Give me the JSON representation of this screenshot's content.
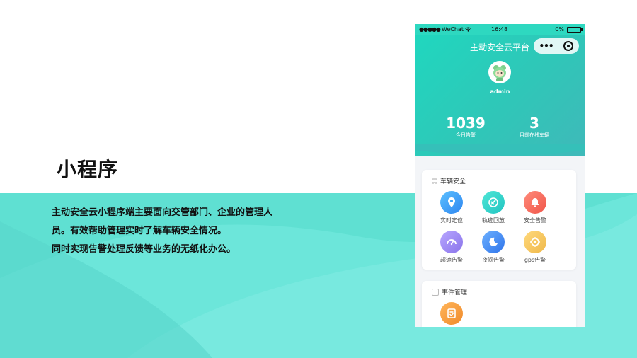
{
  "slide": {
    "title": "小程序",
    "description_lines": [
      "主动安全云小程序端主要面向交管部门、企业的管理人",
      "员。有效帮助管理实时了解车辆安全情况。",
      "同时实现告警处理反馈等业务的无纸化办公。"
    ]
  },
  "phone": {
    "statusbar": {
      "carrier": "WeChat",
      "time": "16:48",
      "battery": "0%"
    },
    "nav_title": "主动安全云平台",
    "user": {
      "name": "admin"
    },
    "stats": [
      {
        "value": "1039",
        "label": "今日告警"
      },
      {
        "value": "3",
        "label": "目前在线车辆"
      }
    ],
    "sections": [
      {
        "title": "车辆安全",
        "items": [
          {
            "label": "实时定位",
            "icon": "location-pin-icon",
            "color": "#3fa2f7"
          },
          {
            "label": "轨迹回放",
            "icon": "track-replay-icon",
            "color": "#2dd4c4"
          },
          {
            "label": "安全告警",
            "icon": "bell-icon",
            "color": "#f26a5c"
          },
          {
            "label": "超速告警",
            "icon": "speedometer-icon",
            "color": "#9a86f0"
          },
          {
            "label": "夜间告警",
            "icon": "moon-icon",
            "color": "#3b86f2"
          },
          {
            "label": "gps告警",
            "icon": "gps-target-icon",
            "color": "#f3c85e"
          }
        ]
      },
      {
        "title": "事件管理",
        "items": [
          {
            "label": "",
            "icon": "checklist-icon",
            "color": "#f5a23e"
          }
        ]
      }
    ]
  }
}
